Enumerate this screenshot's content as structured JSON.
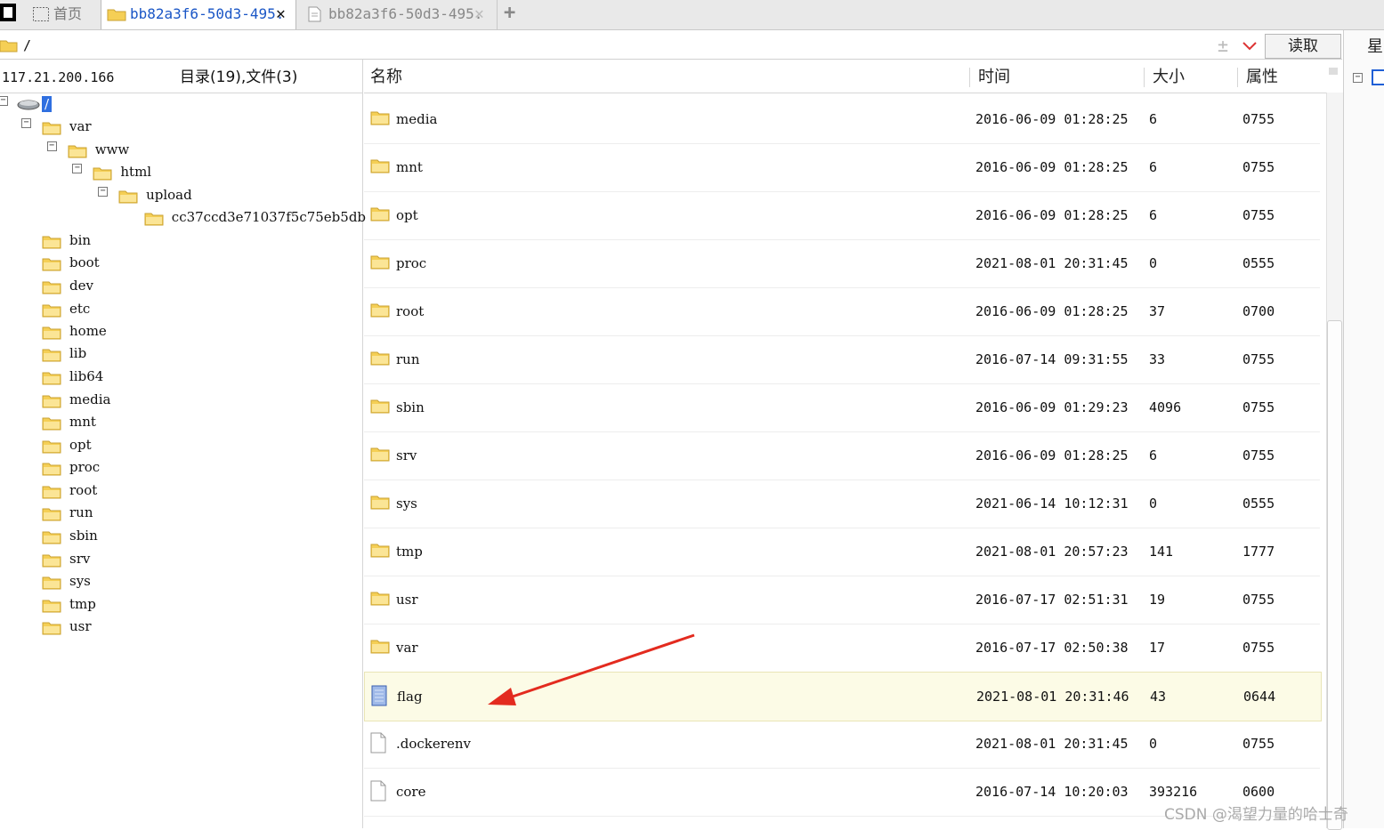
{
  "tabs": [
    {
      "label": "首页"
    },
    {
      "label": "bb82a3f6-50d3-495."
    },
    {
      "label": "bb82a3f6-50d3-495."
    }
  ],
  "tab_close_glyph": "✕",
  "tab_add_glyph": "+",
  "path": {
    "value": "/",
    "read_button": "读取",
    "right_label": "星"
  },
  "left": {
    "host": "117.21.200.166",
    "summary": "目录(19),文件(3)",
    "tree": [
      {
        "label": "/",
        "level": 0,
        "expanded": true
      },
      {
        "label": "var",
        "level": 1,
        "expanded": true
      },
      {
        "label": "www",
        "level": 2,
        "expanded": true
      },
      {
        "label": "html",
        "level": 3,
        "expanded": true
      },
      {
        "label": "upload",
        "level": 4,
        "expanded": true
      },
      {
        "label": "cc37ccd3e71037f5c75eb5db",
        "level": 5
      },
      {
        "label": "bin",
        "level": 1
      },
      {
        "label": "boot",
        "level": 1
      },
      {
        "label": "dev",
        "level": 1
      },
      {
        "label": "etc",
        "level": 1
      },
      {
        "label": "home",
        "level": 1
      },
      {
        "label": "lib",
        "level": 1
      },
      {
        "label": "lib64",
        "level": 1
      },
      {
        "label": "media",
        "level": 1
      },
      {
        "label": "mnt",
        "level": 1
      },
      {
        "label": "opt",
        "level": 1
      },
      {
        "label": "proc",
        "level": 1
      },
      {
        "label": "root",
        "level": 1
      },
      {
        "label": "run",
        "level": 1
      },
      {
        "label": "sbin",
        "level": 1
      },
      {
        "label": "srv",
        "level": 1
      },
      {
        "label": "sys",
        "level": 1
      },
      {
        "label": "tmp",
        "level": 1
      },
      {
        "label": "usr",
        "level": 1
      }
    ]
  },
  "columns": {
    "name": "名称",
    "time": "时间",
    "size": "大小",
    "attr": "属性"
  },
  "files": [
    {
      "name": "media",
      "type": "folder",
      "time": "2016-06-09 01:28:25",
      "size": "6",
      "perm": "0755"
    },
    {
      "name": "mnt",
      "type": "folder",
      "time": "2016-06-09 01:28:25",
      "size": "6",
      "perm": "0755"
    },
    {
      "name": "opt",
      "type": "folder",
      "time": "2016-06-09 01:28:25",
      "size": "6",
      "perm": "0755"
    },
    {
      "name": "proc",
      "type": "folder",
      "time": "2021-08-01 20:31:45",
      "size": "0",
      "perm": "0555"
    },
    {
      "name": "root",
      "type": "folder",
      "time": "2016-06-09 01:28:25",
      "size": "37",
      "perm": "0700"
    },
    {
      "name": "run",
      "type": "folder",
      "time": "2016-07-14 09:31:55",
      "size": "33",
      "perm": "0755"
    },
    {
      "name": "sbin",
      "type": "folder",
      "time": "2016-06-09 01:29:23",
      "size": "4096",
      "perm": "0755"
    },
    {
      "name": "srv",
      "type": "folder",
      "time": "2016-06-09 01:28:25",
      "size": "6",
      "perm": "0755"
    },
    {
      "name": "sys",
      "type": "folder",
      "time": "2021-06-14 10:12:31",
      "size": "0",
      "perm": "0555"
    },
    {
      "name": "tmp",
      "type": "folder",
      "time": "2021-08-01 20:57:23",
      "size": "141",
      "perm": "1777"
    },
    {
      "name": "usr",
      "type": "folder",
      "time": "2016-07-17 02:51:31",
      "size": "19",
      "perm": "0755"
    },
    {
      "name": "var",
      "type": "folder",
      "time": "2016-07-17 02:50:38",
      "size": "17",
      "perm": "0755"
    },
    {
      "name": "flag",
      "type": "text-file",
      "time": "2021-08-01 20:31:46",
      "size": "43",
      "perm": "0644",
      "highlighted": true
    },
    {
      "name": ".dockerenv",
      "type": "file",
      "time": "2021-08-01 20:31:45",
      "size": "0",
      "perm": "0755"
    },
    {
      "name": "core",
      "type": "file",
      "time": "2016-07-14 10:20:03",
      "size": "393216",
      "perm": "0600"
    }
  ],
  "watermark": "CSDN @渴望力量的哈士奇",
  "colors": {
    "folder": "#f5cf55",
    "folder_border": "#c9a232",
    "arrow": "#e32b1f",
    "highlight": "#fcfbe6",
    "active_tab_text": "#1a56c6"
  }
}
